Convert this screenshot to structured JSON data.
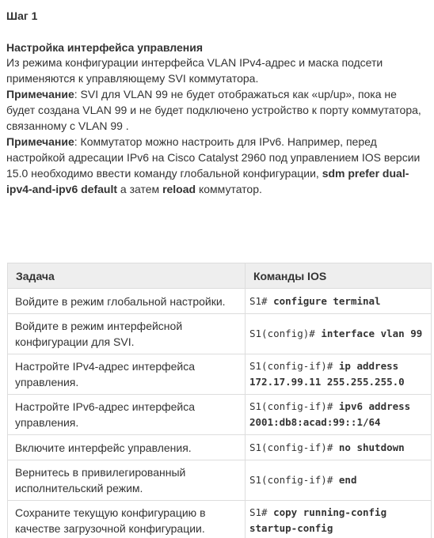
{
  "step_title": "Шаг 1",
  "section_title": "Настройка интерфейса управления",
  "intro": "Из режима конфигурации интерфейса VLAN IPv4-адрес и маска подсети применяются к управляющему SVI коммутатора.",
  "note1": {
    "label": "Примечание",
    "text": ": SVI для VLAN 99 не будет отображаться как «up/up», пока не будет создана VLAN 99 и не будет подключено устройство к порту коммутатора, связанному с VLAN 99 ."
  },
  "note2": {
    "label": "Примечание",
    "text1": ": Коммутатор можно настроить для IPv6. Например, перед настройкой адресации IPv6 на Cisco Catalyst 2960 под управлением IOS версии 15.0 необходимо ввести команду глобальной конфигурации, ",
    "cmd1": "sdm prefer dual-ipv4-and-ipv6 default",
    "text2": " а затем ",
    "cmd2": "reload",
    "text3": " коммутатор."
  },
  "table": {
    "headers": [
      "Задача",
      "Команды IOS"
    ],
    "rows": [
      {
        "task": "Войдите в режим глобальной настройки.",
        "prompt": "S1#",
        "command": "configure terminal"
      },
      {
        "task": "Войдите в режим интерфейсной конфигурации для SVI.",
        "prompt": "S1(config)#",
        "command": "interface vlan 99"
      },
      {
        "task": "Настройте IPv4-адрес интерфейса управления.",
        "prompt": "S1(config-if)#",
        "command": "ip address 172.17.99.11 255.255.255.0"
      },
      {
        "task": "Настройте IPv6-адрес интерфейса управления.",
        "prompt": "S1(config-if)#",
        "command": "ipv6 address 2001:db8:acad:99::1/64"
      },
      {
        "task": "Включите интерфейс управления.",
        "prompt": "S1(config-if)#",
        "command": "no shutdown"
      },
      {
        "task": "Вернитесь в привилегированный исполнительский режим.",
        "prompt": "S1(config-if)#",
        "command": "end"
      },
      {
        "task": "Сохраните текущую конфигурацию в качестве загрузочной конфигурации.",
        "prompt": "S1#",
        "command": "copy running-config startup-config"
      }
    ]
  }
}
